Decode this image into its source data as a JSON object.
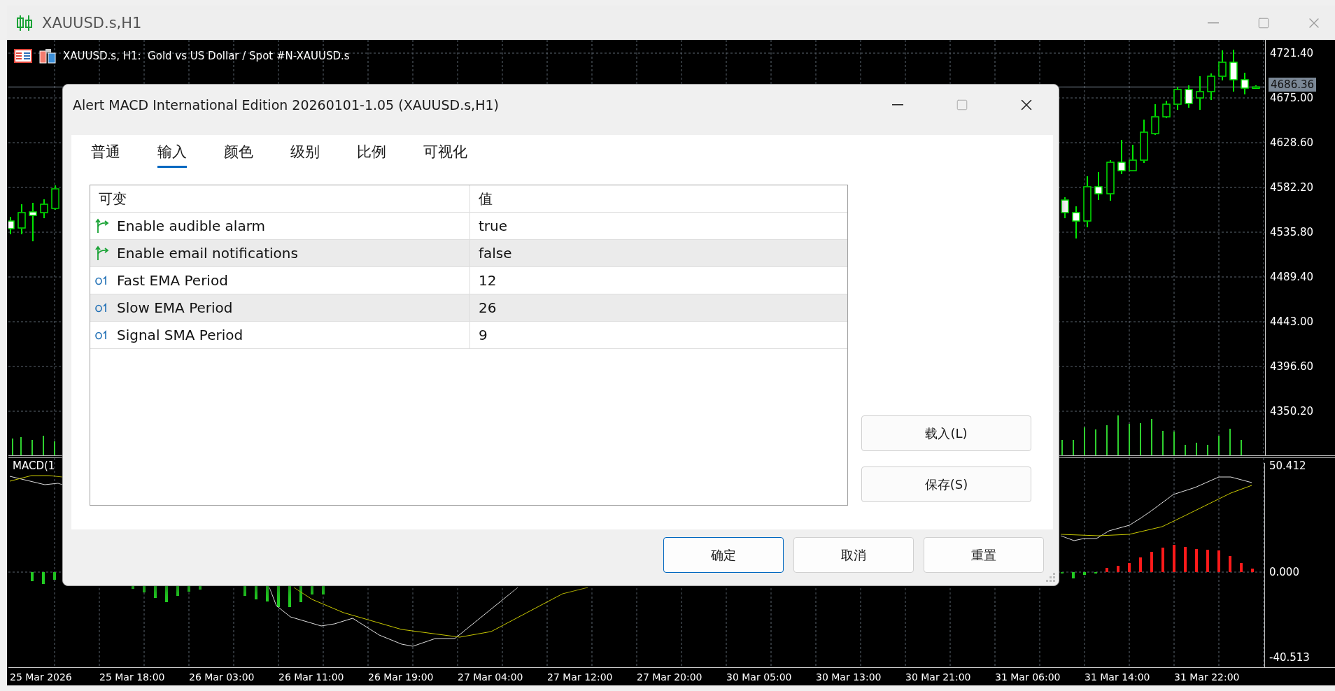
{
  "window": {
    "title": "XAUUSD.s,H1"
  },
  "chart": {
    "header": "XAUUSD.s, H1:  Gold vs US Dollar / Spot #N-XAUUSD.s",
    "current_price": "4686.36",
    "chart_data": {
      "type": "candlestick",
      "categories": [
        null,
        null,
        null,
        null,
        null,
        null,
        null,
        null,
        null,
        null,
        null,
        null,
        null,
        null,
        null,
        null,
        null,
        null,
        null,
        null,
        null,
        null,
        null,
        null,
        null,
        null,
        null,
        null,
        null,
        null,
        null,
        null,
        null,
        null,
        null,
        null,
        null,
        null,
        null,
        null,
        null,
        null,
        null,
        null,
        null,
        null,
        null,
        null,
        null,
        null,
        null,
        null,
        null,
        null,
        null,
        null,
        null,
        null,
        null,
        null,
        null,
        null,
        null,
        null,
        null,
        null,
        null,
        null,
        null,
        null,
        null,
        null,
        null,
        null,
        null,
        null,
        null,
        null,
        null,
        null,
        null,
        null,
        null,
        null,
        null,
        null,
        null,
        null,
        null,
        null,
        null,
        null,
        null,
        null,
        null,
        null,
        null,
        null,
        null,
        null,
        null,
        null,
        null,
        null,
        null,
        null,
        null,
        null,
        null,
        null,
        null,
        null
      ],
      "ohlc": [
        [
          4547.4,
          4551.75,
          4533.63,
          4539.43
        ],
        [
          4540.15,
          4564.8,
          4533.63,
          4556.1
        ],
        [
          4556.83,
          4566.25,
          4526.38,
          4553.2
        ],
        [
          4556.1,
          4569.88,
          4550.3,
          4564.8
        ],
        [
          4560.45,
          4584.38,
          4559.0,
          4580.75
        ],
        null,
        null,
        null,
        null,
        null,
        null,
        null,
        null,
        null,
        null,
        null,
        null,
        null,
        null,
        null,
        null,
        null,
        null,
        null,
        null,
        null,
        null,
        null,
        null,
        null,
        null,
        null,
        null,
        null,
        null,
        null,
        null,
        null,
        null,
        null,
        null,
        null,
        null,
        null,
        null,
        null,
        null,
        null,
        null,
        null,
        null,
        null,
        null,
        null,
        null,
        null,
        null,
        null,
        null,
        null,
        null,
        null,
        null,
        null,
        null,
        null,
        null,
        null,
        null,
        null,
        null,
        null,
        null,
        null,
        null,
        null,
        null,
        null,
        null,
        null,
        null,
        null,
        null,
        null,
        null,
        null,
        null,
        null,
        null,
        null,
        null,
        null,
        null,
        null,
        [
          4569.15,
          4572.05,
          4550.3,
          4556.1
        ],
        [
          4556.1,
          4562.63,
          4529.28,
          4547.4
        ],
        [
          4547.4,
          4593.8,
          4540.88,
          4582.93
        ],
        [
          4582.93,
          4598.15,
          4569.15,
          4575.68
        ],
        [
          4575.68,
          4610.48,
          4568.43,
          4608.3
        ],
        [
          4608.3,
          4631.5,
          4595.98,
          4599.6
        ],
        [
          4599.6,
          4626.43,
          4599.6,
          4610.48
        ],
        [
          4610.48,
          4652.53,
          4607.58,
          4639.48
        ],
        [
          4638.03,
          4668.48,
          4636.58,
          4655.43
        ],
        [
          4655.43,
          4672.1,
          4653.98,
          4668.48
        ],
        [
          4668.48,
          4686.6,
          4662.68,
          4683.7
        ],
        [
          4683.7,
          4688.05,
          4664.85,
          4669.2
        ],
        [
          4675.0,
          4697.48,
          4662.68,
          4681.53
        ],
        [
          4681.53,
          4700.38,
          4672.83,
          4697.48
        ],
        [
          4697.48,
          4724.3,
          4693.13,
          4711.98
        ],
        [
          4711.98,
          4725.03,
          4681.53,
          4693.85
        ],
        [
          4693.85,
          4701.1,
          4678.63,
          4685.15
        ],
        [
          4685.15,
          4688.05,
          4684.43,
          4686.36
        ]
      ],
      "ylim": [
        4304.53,
        4735.18
      ],
      "yticks": [
        {
          "value": 4721.4,
          "label": "4721.40"
        },
        {
          "value": 4675,
          "label": "4675.00"
        },
        {
          "value": 4628.6,
          "label": "4628.60"
        },
        {
          "value": 4582.2,
          "label": "4582.20"
        },
        {
          "value": 4535.8,
          "label": "4535.80"
        },
        {
          "value": 4489.4,
          "label": "4489.40"
        },
        {
          "value": 4443,
          "label": "4443.00"
        },
        {
          "value": 4396.6,
          "label": "4396.60"
        },
        {
          "value": 4350.2,
          "label": "4350.20"
        }
      ],
      "grid": true,
      "ref_lines": [
        {
          "axis": "y",
          "value": 4686.36
        }
      ]
    },
    "indicator_label": "MACD(1",
    "indicator_labels": [
      "50.412",
      "0.000",
      "-40.513"
    ],
    "time_labels": [
      "25 Mar 2026",
      "25 Mar 18:00",
      "26 Mar 03:00",
      "26 Mar 11:00",
      "26 Mar 19:00",
      "27 Mar 04:00",
      "27 Mar 12:00",
      "27 Mar 20:00",
      "30 Mar 05:00",
      "30 Mar 13:00",
      "30 Mar 21:00",
      "31 Mar 06:00",
      "31 Mar 14:00",
      "31 Mar 22:00"
    ]
  },
  "dialog": {
    "title": "Alert MACD International Edition 20260101-1.05 (XAUUSD.s,H1)",
    "tabs": [
      {
        "label": "普通",
        "selected": false
      },
      {
        "label": "输入",
        "selected": true
      },
      {
        "label": "颜色",
        "selected": false
      },
      {
        "label": "级别",
        "selected": false
      },
      {
        "label": "比例",
        "selected": false
      },
      {
        "label": "可视化",
        "selected": false
      }
    ],
    "table": {
      "columns": [
        "可变",
        "值"
      ],
      "rows": [
        {
          "kind": "bool",
          "name": "Enable audible alarm",
          "value": "true"
        },
        {
          "kind": "bool",
          "name": "Enable email notifications",
          "value": "false"
        },
        {
          "kind": "int",
          "name": "Fast EMA Period",
          "value": "12"
        },
        {
          "kind": "int",
          "name": "Slow EMA Period",
          "value": "26"
        },
        {
          "kind": "int",
          "name": "Signal SMA Period",
          "value": "9"
        }
      ]
    },
    "side_buttons": [
      "载入(L)",
      "保存(S)"
    ],
    "buttons": [
      {
        "label": "确定",
        "default": true
      },
      {
        "label": "取消",
        "default": false
      },
      {
        "label": "重置",
        "default": false
      }
    ]
  }
}
